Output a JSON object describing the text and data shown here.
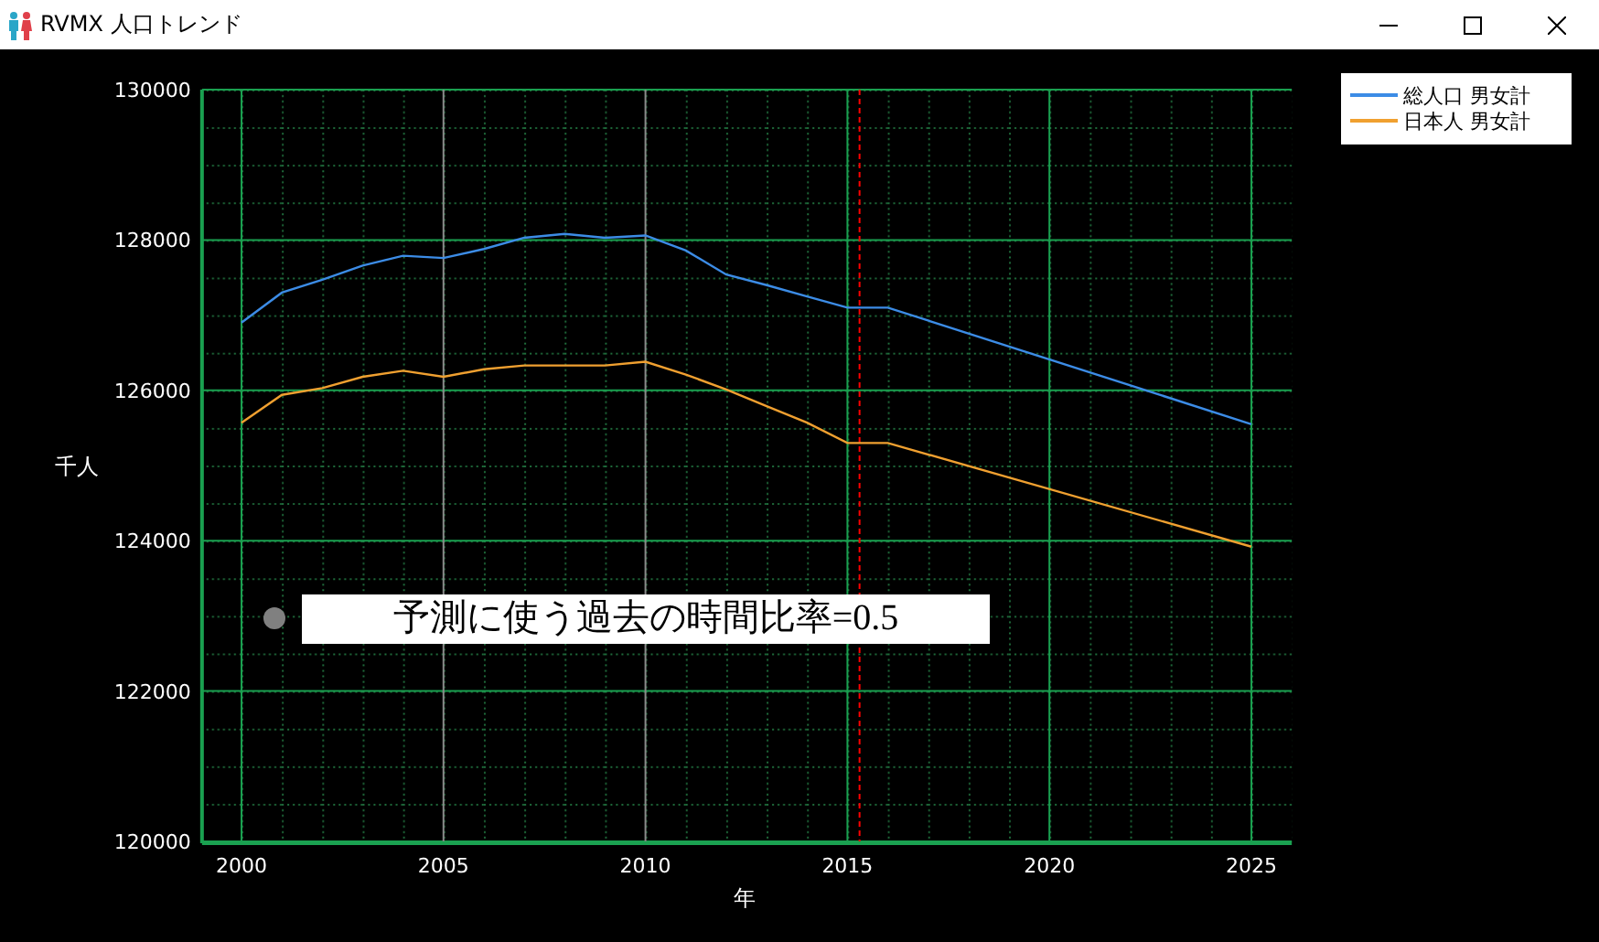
{
  "window": {
    "title": "RVMX 人口トレンド",
    "controls": [
      {
        "kind": "minimize"
      },
      {
        "kind": "maximize"
      },
      {
        "kind": "close"
      }
    ]
  },
  "chart": {
    "chart_data": {
      "type": "line",
      "xlabel": "年",
      "ylabel": "千人",
      "x": [
        2000,
        2001,
        2002,
        2003,
        2004,
        2005,
        2006,
        2007,
        2008,
        2009,
        2010,
        2011,
        2012,
        2013,
        2014,
        2015,
        2016,
        2025
      ],
      "series": [
        {
          "name": "総人口 男女計",
          "color": "#3c8ce6",
          "values": [
            126900,
            127300,
            127470,
            127660,
            127790,
            127760,
            127880,
            128030,
            128080,
            128030,
            128060,
            127860,
            127540,
            127400,
            127250,
            127100,
            127100,
            125550
          ]
        },
        {
          "name": "日本人 男女計",
          "color": "#f0a030",
          "values": [
            125570,
            125940,
            126030,
            126180,
            126260,
            126180,
            126280,
            126330,
            126330,
            126330,
            126380,
            126210,
            126010,
            125790,
            125570,
            125300,
            125300,
            123920
          ]
        }
      ],
      "xlim": [
        1999,
        2026
      ],
      "ylim": [
        120000,
        130000
      ],
      "xticks": [
        2000,
        2005,
        2010,
        2015,
        2020,
        2025
      ],
      "yticks": [
        120000,
        122000,
        124000,
        126000,
        128000,
        130000
      ],
      "grid": {
        "major": true,
        "minor": true
      },
      "legend": "upper right",
      "ref_lines": [
        {
          "axis": "x",
          "value": 2015.3,
          "color": "#ff0000"
        }
      ],
      "annotations": [
        "予測に使う過去の時間比率=0.5"
      ]
    }
  }
}
